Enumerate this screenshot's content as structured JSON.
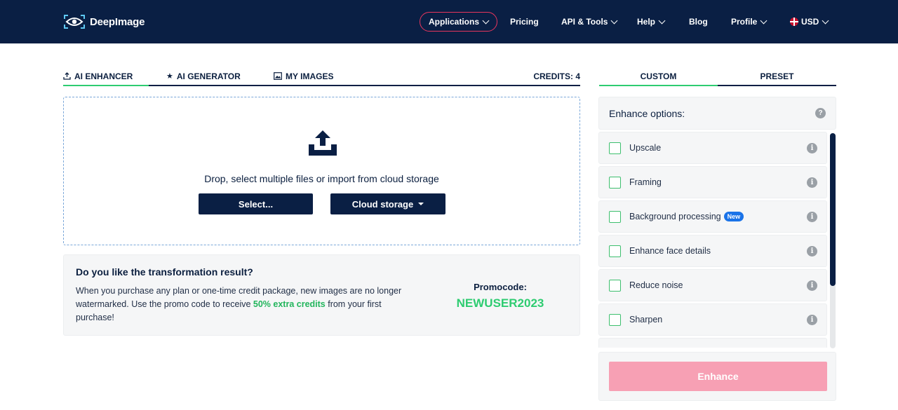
{
  "header": {
    "logo_text": "DeepImage",
    "nav": {
      "applications": "Applications",
      "pricing": "Pricing",
      "api_tools": "API & Tools",
      "help": "Help",
      "blog": "Blog",
      "profile": "Profile",
      "currency": "USD"
    }
  },
  "tabs": {
    "enhancer": "AI ENHANCER",
    "generator": "AI GENERATOR",
    "my_images": "MY IMAGES",
    "credits": "CREDITS: 4"
  },
  "dropzone": {
    "text": "Drop, select multiple files or import from cloud storage",
    "select_label": "Select...",
    "cloud_label": "Cloud storage"
  },
  "promo": {
    "title": "Do you like the transformation result?",
    "body_before": "When you purchase any plan or one-time credit package, new images are no longer watermarked. Use the promo code to receive ",
    "body_highlight": "50% extra credits",
    "body_after": " from your first purchase!",
    "label": "Promocode:",
    "code": "NEWUSER2023"
  },
  "right_tabs": {
    "custom": "CUSTOM",
    "preset": "PRESET"
  },
  "options": {
    "header": "Enhance options:",
    "items": [
      {
        "label": "Upscale",
        "badge": ""
      },
      {
        "label": "Framing",
        "badge": ""
      },
      {
        "label": "Background processing",
        "badge": "New"
      },
      {
        "label": "Enhance face details",
        "badge": ""
      },
      {
        "label": "Reduce noise",
        "badge": ""
      },
      {
        "label": "Sharpen",
        "badge": ""
      }
    ]
  },
  "enhance_label": "Enhance",
  "colors": {
    "navy": "#0a1f44",
    "green": "#2ecc71",
    "pink": "#f7a0b4",
    "accent_red": "#e8365d",
    "badge_blue": "#1a73e8"
  }
}
